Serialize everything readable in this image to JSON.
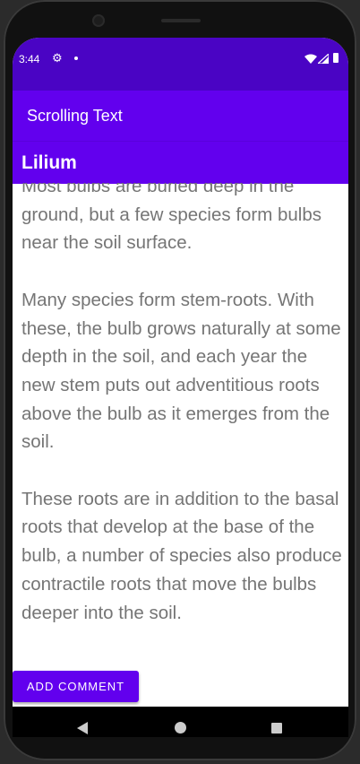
{
  "status_bar": {
    "time": "3:44",
    "icons": [
      "gear-icon",
      "dot-icon",
      "wifi-icon",
      "signal-icon",
      "battery-icon"
    ]
  },
  "app_bar": {
    "title": "Scrolling Text"
  },
  "article": {
    "heading": "Lilium",
    "body": "Most bulbs are buried deep in the ground, but a few species form bulbs near the soil surface.\n\nMany species form stem-roots. With these, the bulb grows naturally at some depth in the soil, and each year the new stem puts out adventitious roots above the bulb as it emerges from the soil.\n\nThese roots are in addition to the basal roots that develop at the base of the bulb, a number of species also produce contractile roots that move the bulbs deeper into the soil."
  },
  "actions": {
    "add_comment_label": "ADD COMMENT"
  },
  "nav_bar": {
    "icons": [
      "back-icon",
      "home-icon",
      "recents-icon"
    ]
  },
  "colors": {
    "status_bar": "#4a04c4",
    "app_bar": "#6200ee",
    "body_text": "#757575"
  }
}
